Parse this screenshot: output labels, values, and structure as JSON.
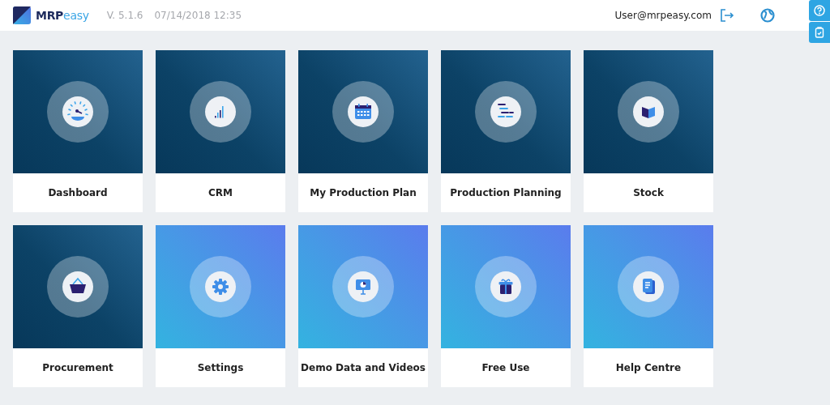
{
  "header": {
    "logo": {
      "strong": "MRP",
      "light": "easy"
    },
    "version": "V. 5.1.6",
    "datetime": "07/14/2018 12:35",
    "user": "User@mrpeasy.com"
  },
  "tiles": [
    {
      "label": "Dashboard",
      "accent": false,
      "kind": "gauge"
    },
    {
      "label": "CRM",
      "accent": false,
      "kind": "bars"
    },
    {
      "label": "My Production Plan",
      "accent": false,
      "kind": "calendar"
    },
    {
      "label": "Production Planning",
      "accent": false,
      "kind": "gantt"
    },
    {
      "label": "Stock",
      "accent": false,
      "kind": "book"
    },
    {
      "label": "Procurement",
      "accent": false,
      "kind": "basket"
    },
    {
      "label": "Settings",
      "accent": true,
      "kind": "gear"
    },
    {
      "label": "Demo Data and Videos",
      "accent": true,
      "kind": "presentation"
    },
    {
      "label": "Free Use",
      "accent": true,
      "kind": "gift"
    },
    {
      "label": "Help Centre",
      "accent": true,
      "kind": "document"
    }
  ]
}
